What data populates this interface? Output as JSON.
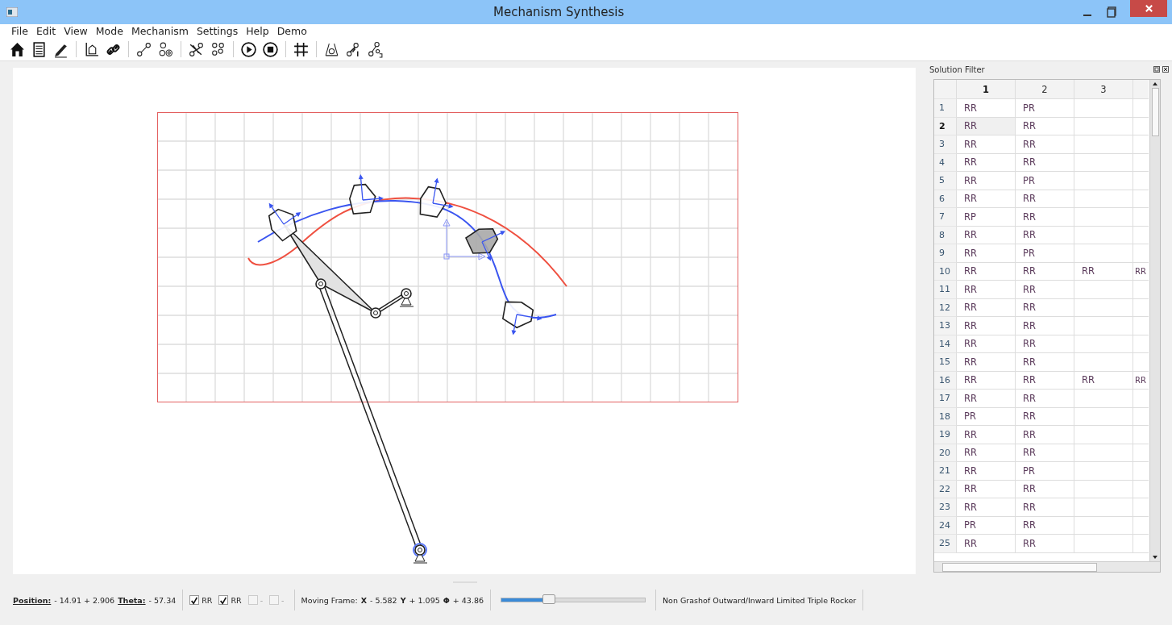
{
  "window": {
    "title": "Mechanism Synthesis"
  },
  "menu": [
    "File",
    "Edit",
    "View",
    "Mode",
    "Mechanism",
    "Settings",
    "Help",
    "Demo"
  ],
  "solution_filter": {
    "title": "Solution Filter",
    "columns": [
      {
        "label": "1",
        "selected": true
      },
      {
        "label": "2",
        "selected": false
      },
      {
        "label": "3",
        "selected": false
      },
      {
        "selected": false
      }
    ],
    "rows": [
      {
        "label": "1",
        "selected": false,
        "cells": [
          "RR",
          "PR"
        ]
      },
      {
        "label": "2",
        "selected": true,
        "cells": [
          "RR",
          "RR"
        ]
      },
      {
        "label": "3",
        "selected": false,
        "cells": [
          "RR",
          "RR"
        ]
      },
      {
        "label": "4",
        "selected": false,
        "cells": [
          "RR",
          "RR"
        ]
      },
      {
        "label": "5",
        "selected": false,
        "cells": [
          "RR",
          "PR"
        ]
      },
      {
        "label": "6",
        "selected": false,
        "cells": [
          "RR",
          "RR"
        ]
      },
      {
        "label": "7",
        "selected": false,
        "cells": [
          "RP",
          "RR"
        ]
      },
      {
        "label": "8",
        "selected": false,
        "cells": [
          "RR",
          "RR"
        ]
      },
      {
        "label": "9",
        "selected": false,
        "cells": [
          "RR",
          "PR"
        ]
      },
      {
        "label": "10",
        "selected": false,
        "cells": [
          "RR",
          "RR",
          "RR",
          "RR"
        ]
      },
      {
        "label": "11",
        "selected": false,
        "cells": [
          "RR",
          "RR"
        ]
      },
      {
        "label": "12",
        "selected": false,
        "cells": [
          "RR",
          "RR"
        ]
      },
      {
        "label": "13",
        "selected": false,
        "cells": [
          "RR",
          "RR"
        ]
      },
      {
        "label": "14",
        "selected": false,
        "cells": [
          "RR",
          "RR"
        ]
      },
      {
        "label": "15",
        "selected": false,
        "cells": [
          "RR",
          "RR"
        ]
      },
      {
        "label": "16",
        "selected": false,
        "cells": [
          "RR",
          "RR",
          "RR",
          "RR"
        ]
      },
      {
        "label": "17",
        "selected": false,
        "cells": [
          "RR",
          "RR"
        ]
      },
      {
        "label": "18",
        "selected": false,
        "cells": [
          "PR",
          "RR"
        ]
      },
      {
        "label": "19",
        "selected": false,
        "cells": [
          "RR",
          "RR"
        ]
      },
      {
        "label": "20",
        "selected": false,
        "cells": [
          "RR",
          "RR"
        ]
      },
      {
        "label": "21",
        "selected": false,
        "cells": [
          "RR",
          "PR"
        ]
      },
      {
        "label": "22",
        "selected": false,
        "cells": [
          "RR",
          "RR"
        ]
      },
      {
        "label": "23",
        "selected": false,
        "cells": [
          "RR",
          "RR"
        ]
      },
      {
        "label": "24",
        "selected": false,
        "cells": [
          "PR",
          "RR"
        ]
      },
      {
        "label": "25",
        "selected": false,
        "cells": [
          "RR",
          "RR"
        ]
      }
    ]
  },
  "status_bar": {
    "position": {
      "label": "Position:",
      "value": "- 14.91 + 2.906"
    },
    "theta": {
      "label": "Theta:",
      "value": "- 57.34"
    },
    "filters": [
      {
        "label": "RR",
        "checked": true
      },
      {
        "label": "RR",
        "checked": true
      },
      {
        "label": "-",
        "checked": false
      },
      {
        "label": "-",
        "checked": false
      }
    ],
    "moving_frame": {
      "label": "Moving Frame:",
      "parts": [
        {
          "axis": "X",
          "value": "- 5.582"
        },
        {
          "axis": "Y",
          "value": "+ 1.095"
        },
        {
          "axis": "Φ",
          "value": "+ 43.86"
        }
      ]
    },
    "slider": {
      "level": 0.33
    },
    "classification": "Non Grashof Outward/Inward Limited Triple Rocker"
  }
}
